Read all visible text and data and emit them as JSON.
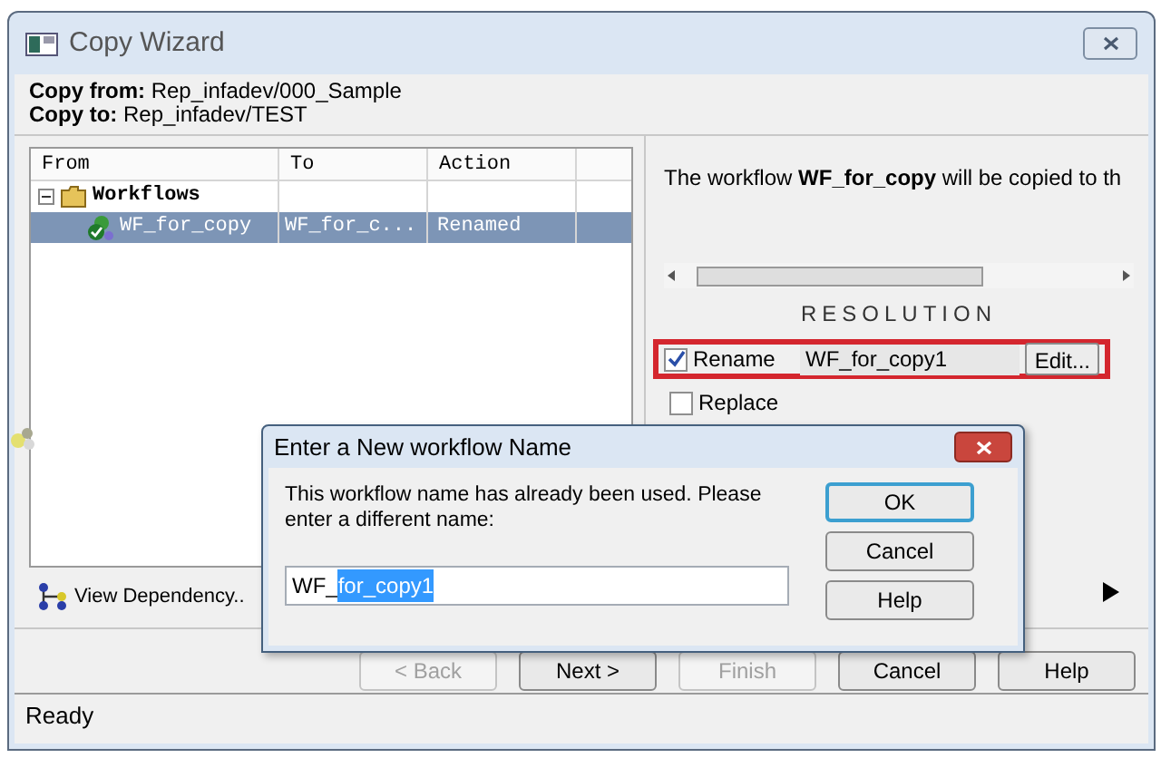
{
  "window": {
    "title": "Copy Wizard"
  },
  "header": {
    "copy_from": "**Copy from:** Rep_infadev/000_Sample",
    "copy_to": "**Copy to:** Rep_infadev/TEST"
  },
  "tree": {
    "columns": [
      "From",
      "To",
      "Action"
    ],
    "rows": [
      {
        "from": "Workflows",
        "expanded": true,
        "selected": false,
        "children": [
          {
            "from": "WF_for_copy",
            "to": "WF_for_c...",
            "action": "Renamed",
            "selected": true
          }
        ]
      }
    ]
  },
  "details": {
    "message": "The workflow **WF_for_copy** will be copied to th"
  },
  "resolution": {
    "title": "RESOLUTION",
    "options": [
      {
        "label": "Rename",
        "checked": true,
        "value": "WF_for_copy1",
        "button": "Edit...",
        "highlighted": true
      },
      {
        "label": "Replace",
        "checked": false,
        "highlighted": false
      }
    ]
  },
  "view_dependency": "View Dependency..",
  "buttons": [
    {
      "label": "< Back",
      "disabled": true
    },
    {
      "label": "Next >",
      "disabled": false
    },
    {
      "label": "Finish",
      "disabled": true
    },
    {
      "label": "Cancel",
      "disabled": false
    },
    {
      "label": "Help",
      "disabled": false
    }
  ],
  "status_bar": "Ready",
  "dialog": {
    "title": "Enter a New workflow Name",
    "message": "This workflow name has already been used. Please enter a different name:",
    "value_prefix": "WF_",
    "value_selected": "for_copy1",
    "buttons": [
      {
        "label": "OK",
        "default": true
      },
      {
        "label": "Cancel",
        "default": false
      },
      {
        "label": "Help",
        "default": false
      }
    ]
  }
}
